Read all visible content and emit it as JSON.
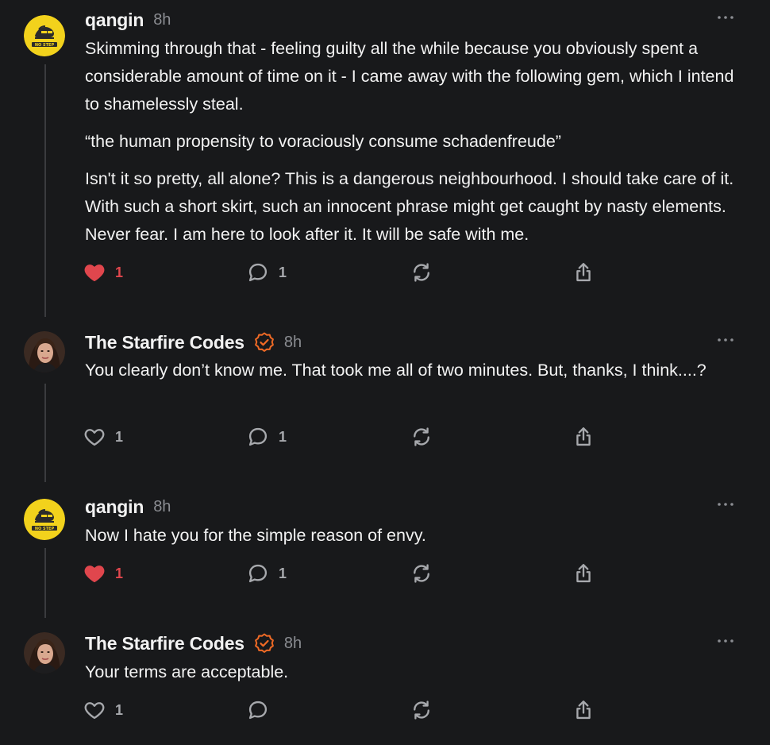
{
  "comments": [
    {
      "author": "qangin",
      "avatar": "no-step-sticker-avatar",
      "verified": false,
      "time": "8h",
      "paragraphs": [
        "Skimming through that - feeling guilty all the while because you obviously spent a considerable amount of time on it - I came away with the following gem, which I intend to shamelessly steal.",
        "“the human propensity to voraciously consume schadenfreude”",
        "Isn't it so pretty, all alone? This is a dangerous neighbourhood. I should take care of it. With such a short skirt, such an innocent phrase might get caught by nasty elements. Never fear. I am here to look after it. It will be safe with me."
      ],
      "likes": "1",
      "liked": true,
      "replies": "1"
    },
    {
      "author": "The Starfire Codes",
      "avatar": "woman-portrait-avatar",
      "verified": true,
      "time": "8h",
      "paragraphs": [
        "You clearly don’t know me. That took me all of two minutes. But, thanks, I think....?"
      ],
      "likes": "1",
      "liked": false,
      "replies": "1"
    },
    {
      "author": "qangin",
      "avatar": "no-step-sticker-avatar",
      "verified": false,
      "time": "8h",
      "paragraphs": [
        "Now I hate you for the simple reason of envy."
      ],
      "likes": "1",
      "liked": true,
      "replies": "1"
    },
    {
      "author": "The Starfire Codes",
      "avatar": "woman-portrait-avatar",
      "verified": true,
      "time": "8h",
      "paragraphs": [
        "Your terms are acceptable."
      ],
      "likes": "1",
      "liked": false,
      "replies": ""
    }
  ],
  "icons": {
    "heart": "heart-icon",
    "reply": "comment-bubble-icon",
    "restack": "restack-icon",
    "share": "share-icon",
    "more": "more-horizontal-icon",
    "verified": "verified-check-icon"
  },
  "colors": {
    "background": "#18191b",
    "text": "#f2f2f2",
    "muted": "#8b8d92",
    "like_active": "#e0464d",
    "verified": "#f06a25"
  }
}
